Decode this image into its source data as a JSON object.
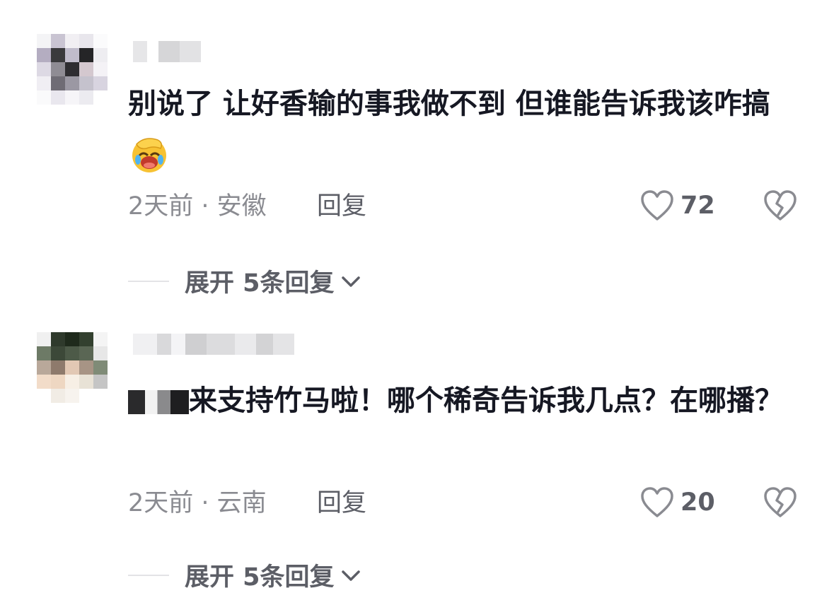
{
  "comments": [
    {
      "text": "别说了 让好香输的事我做不到 但谁能告诉我该咋搞",
      "time_location": "2天前 · 安徽",
      "reply_label": "回复",
      "likes": "72",
      "expand_label": "展开 5条回复",
      "emoji": "face-with-hand-laughing-emoji"
    },
    {
      "text": "来支持竹马啦！哪个稀奇告诉我几点？在哪播？",
      "time_location": "2天前 · 云南",
      "reply_label": "回复",
      "likes": "20",
      "expand_label": "展开 5条回复"
    }
  ],
  "colors": {
    "text": "#161823",
    "meta": "#8a8b91",
    "action": "#5c5e66",
    "icon_stroke": "#8a8b91"
  },
  "icons": [
    "heart-outline-icon",
    "broken-heart-icon",
    "chevron-down-icon"
  ]
}
